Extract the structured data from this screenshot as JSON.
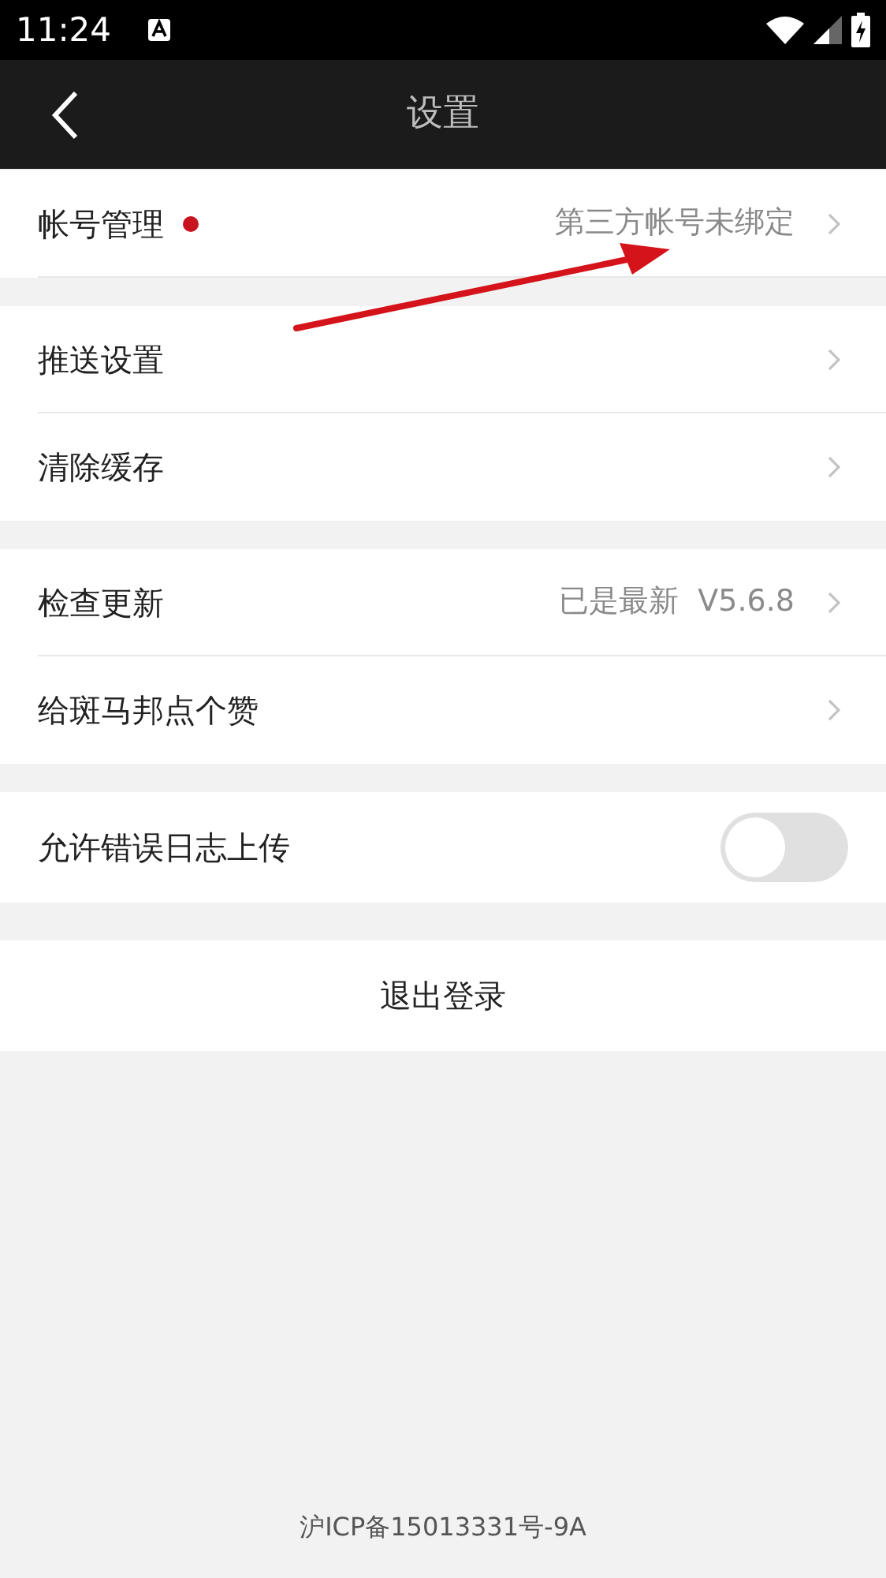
{
  "status_bar": {
    "time": "11:24"
  },
  "nav_bar": {
    "title": "设置"
  },
  "groups": [
    {
      "rows": [
        {
          "kind": "link",
          "label": "帐号管理",
          "badge": true,
          "value": "第三方帐号未绑定"
        }
      ]
    },
    {
      "rows": [
        {
          "kind": "link",
          "label": "推送设置",
          "badge": false
        },
        {
          "kind": "link",
          "label": "清除缓存",
          "badge": false
        }
      ]
    },
    {
      "rows": [
        {
          "kind": "link",
          "label": "检查更新",
          "badge": false,
          "value": "已是最新",
          "version": "V5.6.8"
        },
        {
          "kind": "link",
          "label": "给斑马邦点个赞",
          "badge": false
        }
      ]
    },
    {
      "rows": [
        {
          "kind": "toggle",
          "label": "允许错误日志上传",
          "badge": false,
          "on": false
        }
      ]
    }
  ],
  "logout_button": "退出登录",
  "footer": "沪ICP备15013331号-9A"
}
